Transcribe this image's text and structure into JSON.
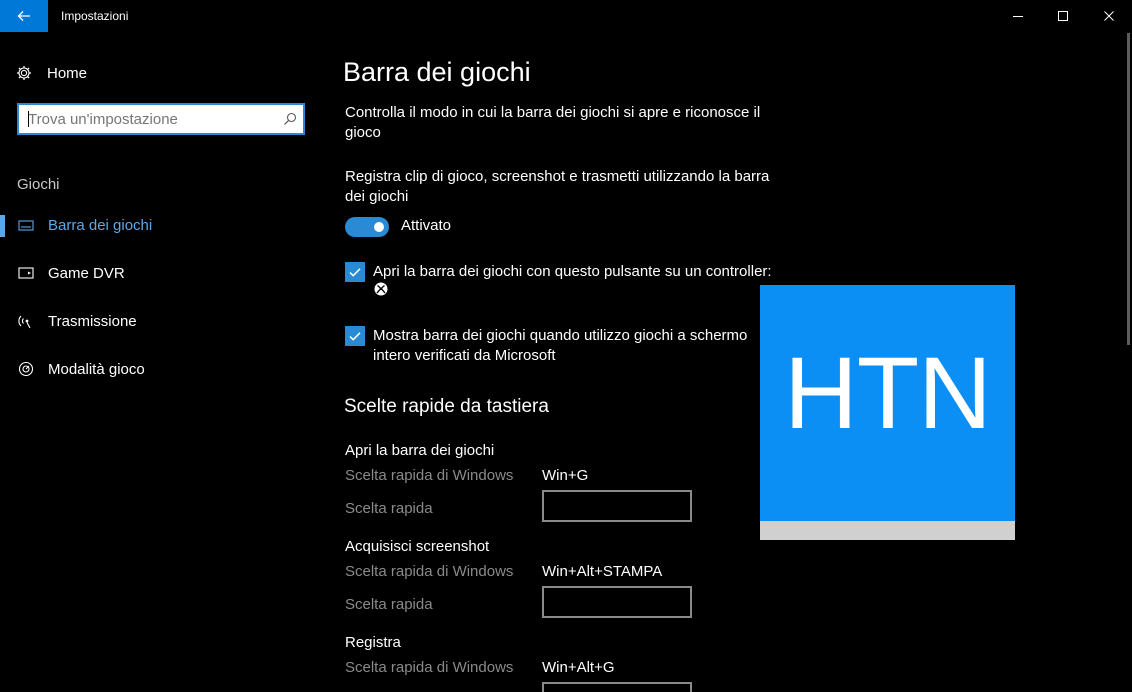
{
  "window": {
    "title": "Impostazioni"
  },
  "sidebar": {
    "home_label": "Home",
    "search_placeholder": "Trova un'impostazione",
    "section_header": "Giochi",
    "items": [
      {
        "label": "Barra dei giochi",
        "icon": "game-bar-icon",
        "active": true
      },
      {
        "label": "Game DVR",
        "icon": "game-dvr-icon",
        "active": false
      },
      {
        "label": "Trasmissione",
        "icon": "broadcast-icon",
        "active": false
      },
      {
        "label": "Modalità gioco",
        "icon": "game-mode-icon",
        "active": false
      }
    ]
  },
  "main": {
    "title": "Barra dei giochi",
    "description": "Controlla il modo in cui la barra dei giochi si apre e riconosce il gioco",
    "record_text": "Registra clip di gioco, screenshot e trasmetti utilizzando la barra dei giochi",
    "toggle": {
      "state_label": "Attivato",
      "on": true
    },
    "checkbox_controller": {
      "label": "Apri la barra dei giochi con questo pulsante su un controller:",
      "checked": true
    },
    "checkbox_fullscreen": {
      "label": "Mostra barra dei giochi quando utilizzo giochi a schermo intero verificati da Microsoft",
      "checked": true
    },
    "shortcuts_header": "Scelte rapide da tastiera",
    "shortcut_groups": [
      {
        "title": "Apri la barra dei giochi",
        "windows_label": "Scelta rapida di Windows",
        "windows_value": "Win+G",
        "custom_label": "Scelta rapida",
        "custom_value": ""
      },
      {
        "title": "Acquisisci screenshot",
        "windows_label": "Scelta rapida di Windows",
        "windows_value": "Win+Alt+STAMPA",
        "custom_label": "Scelta rapida",
        "custom_value": ""
      },
      {
        "title": "Registra",
        "windows_label": "Scelta rapida di Windows",
        "windows_value": "Win+Alt+G",
        "custom_label": "Scelta rapida",
        "custom_value": ""
      }
    ]
  },
  "watermark": {
    "text": "HTN"
  },
  "colors": {
    "accent": "#0078d7",
    "accent_light": "#5ea7e6",
    "toggle_on": "#2a8ad4",
    "watermark_blue": "#0b8ff5"
  }
}
